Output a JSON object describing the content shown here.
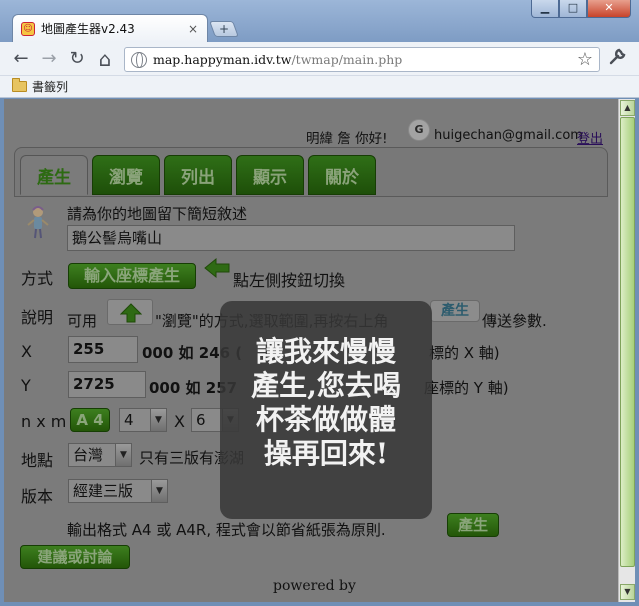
{
  "browser": {
    "tab_title": "地圖產生器v2.43",
    "tab_close": "×",
    "new_tab": "+",
    "window_buttons": {
      "minimize": "▁",
      "maximize": "□",
      "close": "✕"
    },
    "nav": {
      "back": "←",
      "forward": "→",
      "reload": "↻",
      "home": "⌂"
    },
    "url_host": "map.happyman.idv.tw",
    "url_path": "/twmap/main.php",
    "star": "☆",
    "wrench": "🔧",
    "bookmarks_folder": "書籤列"
  },
  "header": {
    "greeting": "明緯 詹 你好!",
    "avatar_letter": "G",
    "email": "huigechan@gmail.com",
    "logout": "登出"
  },
  "tabs": [
    {
      "label": "產生",
      "active": true
    },
    {
      "label": "瀏覽",
      "active": false
    },
    {
      "label": "列出",
      "active": false
    },
    {
      "label": "顯示",
      "active": false
    },
    {
      "label": "關於",
      "active": false
    }
  ],
  "form": {
    "title_prompt": "請為你的地圖留下簡短敘述",
    "title_value": "鵝公髻烏嘴山",
    "mode_label": "方式",
    "mode_button": "輸入座標產生",
    "mode_hint": "點左側按鈕切換",
    "desc_label": "說明",
    "desc_text_1": "可用",
    "desc_text_2": "\"瀏覽\"的方式,選取範圍,再按右上角",
    "desc_button": "產生",
    "desc_text_3": "傳送參數.",
    "x_label": "X",
    "x_value": "255",
    "x_suffix": "000 如 246 (",
    "x_suffix_end": "標的 X 軸)",
    "y_label": "Y",
    "y_value": "2725",
    "y_suffix": "000 如 257",
    "y_suffix_end": "座標的 Y 軸)",
    "nxm_label": "n x m",
    "paper_button": "A 4",
    "n_value": "4",
    "times": "X",
    "m_value": "6",
    "loc_label": "地點",
    "loc_value": "台灣",
    "loc_note": "只有三版有澎湖",
    "ver_label": "版本",
    "ver_value": "經建三版",
    "output_note": "輸出格式 A4 或 A4R, 程式會以節省紙張為原則.",
    "submit_button": "產生",
    "discuss_button": "建議或討論"
  },
  "overlay": {
    "line1": "讓我來慢慢",
    "line2": "產生,您去喝",
    "line3": "杯茶做做體",
    "line4": "操再回來!"
  },
  "footer": {
    "text": "powered by"
  },
  "colors": {
    "accent_green": "#2d6a12",
    "overlay_bg": "#373737",
    "page_dim": "#7b7b7b"
  }
}
